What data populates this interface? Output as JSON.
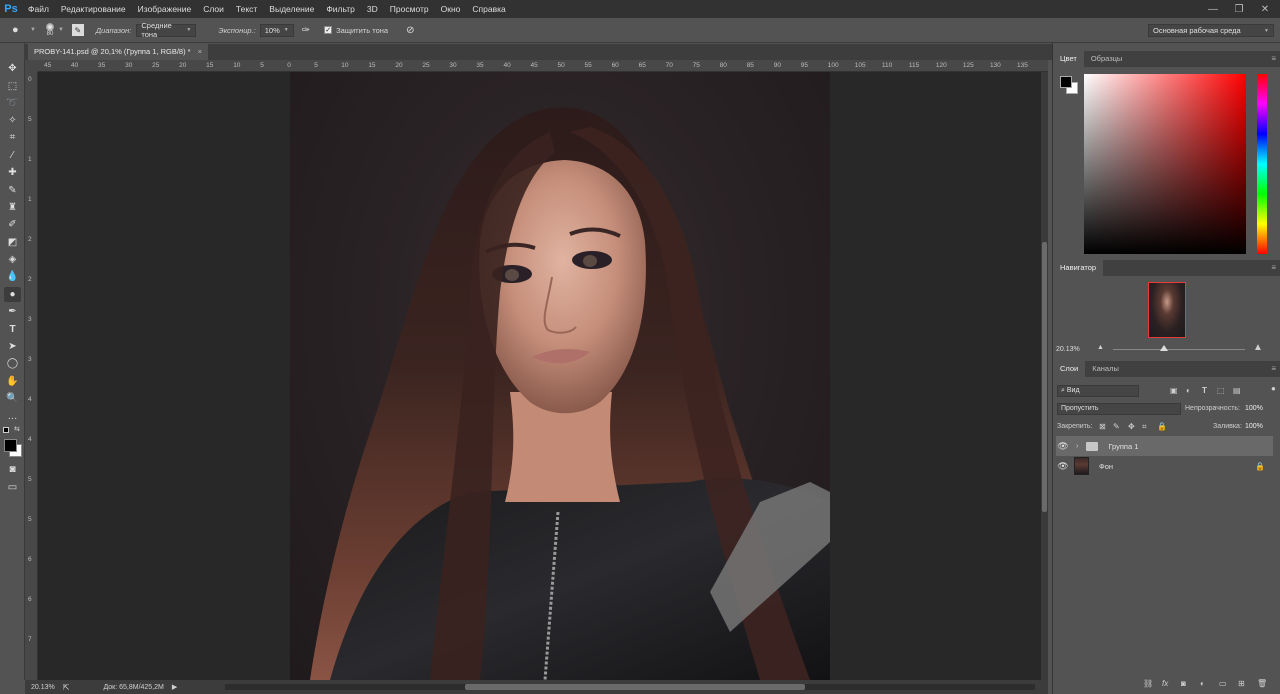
{
  "app": {
    "logo": "Ps"
  },
  "menu": [
    "Файл",
    "Редактирование",
    "Изображение",
    "Слои",
    "Текст",
    "Выделение",
    "Фильтр",
    "3D",
    "Просмотр",
    "Окно",
    "Справка"
  ],
  "window_controls": {
    "minimize": "—",
    "maximize": "❐",
    "close": "✕"
  },
  "options": {
    "brush_size": "80",
    "range_label": "Диапазон:",
    "range_value": "Средние тона",
    "exposure_label": "Экспонир.:",
    "exposure_value": "10%",
    "protect_tones": "Защитить тона",
    "workspace": "Основная рабочая среда"
  },
  "document_tab": {
    "title": "PROBY-141.psd @ 20,1% (Группа 1, RGB/8) *",
    "close": "×"
  },
  "ruler_h": [
    "45",
    "40",
    "35",
    "30",
    "25",
    "20",
    "15",
    "10",
    "5",
    "0",
    "5",
    "10",
    "15",
    "20",
    "25",
    "30",
    "35",
    "40",
    "45",
    "50",
    "55",
    "60",
    "65",
    "70",
    "75",
    "80",
    "85",
    "90",
    "95",
    "100",
    "105",
    "110",
    "115",
    "120",
    "125",
    "130",
    "135"
  ],
  "ruler_v": [
    "0",
    "5",
    "1",
    "1",
    "2",
    "2",
    "3",
    "3",
    "4",
    "4",
    "5",
    "5",
    "6",
    "6",
    "7"
  ],
  "status": {
    "zoom": "20.13%",
    "doc": "Док: 65,8M/425,2M"
  },
  "color_panel": {
    "tabs": [
      "Цвет",
      "Образцы"
    ]
  },
  "navigator": {
    "title": "Навигатор",
    "zoom": "20.13%"
  },
  "layers_panel": {
    "tabs": [
      "Слои",
      "Каналы"
    ],
    "filter": "Вид",
    "blend_mode": "Пропустить",
    "opacity_label": "Непрозрачность:",
    "opacity_value": "100%",
    "lock_label": "Закрепить:",
    "fill_label": "Заливка:",
    "fill_value": "100%",
    "layers": [
      {
        "name": "Группа 1",
        "type": "group"
      },
      {
        "name": "Фон",
        "type": "image"
      }
    ]
  }
}
